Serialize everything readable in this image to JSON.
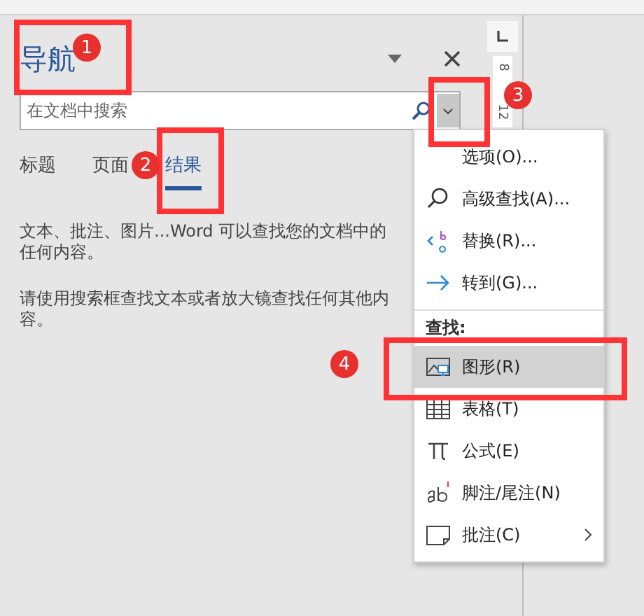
{
  "pane": {
    "title": "导航",
    "search": {
      "placeholder": "在文档中搜索"
    },
    "tabs": [
      {
        "label": "标题",
        "selected": false
      },
      {
        "label": "页面",
        "selected": false
      },
      {
        "label": "结果",
        "selected": true
      }
    ],
    "messages": [
      "文本、批注、图片...Word 可以查找您的文档中的任何内容。",
      "请使用搜索框查找文本或者放大镜查找任何其他内容。"
    ]
  },
  "ruler": {
    "labels": [
      "8",
      "12"
    ]
  },
  "menu": {
    "items": [
      {
        "kind": "item",
        "label": "选项(O)...",
        "selected": false,
        "submenu": false
      },
      {
        "kind": "item",
        "label": "高级查找(A)...",
        "selected": false,
        "submenu": false
      },
      {
        "kind": "item",
        "label": "替换(R)...",
        "selected": false,
        "submenu": false
      },
      {
        "kind": "item",
        "label": "转到(G)...",
        "selected": false,
        "submenu": false
      },
      {
        "kind": "heading",
        "label": "查找:"
      },
      {
        "kind": "item",
        "label": "图形(R)",
        "selected": true,
        "submenu": false
      },
      {
        "kind": "item",
        "label": "表格(T)",
        "selected": false,
        "submenu": false
      },
      {
        "kind": "item",
        "label": "公式(E)",
        "selected": false,
        "submenu": false
      },
      {
        "kind": "item",
        "label": "脚注/尾注(N)",
        "selected": false,
        "submenu": false
      },
      {
        "kind": "item",
        "label": "批注(C)",
        "selected": false,
        "submenu": true
      }
    ]
  },
  "annotations": [
    {
      "label": "1"
    },
    {
      "label": "2"
    },
    {
      "label": "3"
    },
    {
      "label": "4"
    }
  ]
}
